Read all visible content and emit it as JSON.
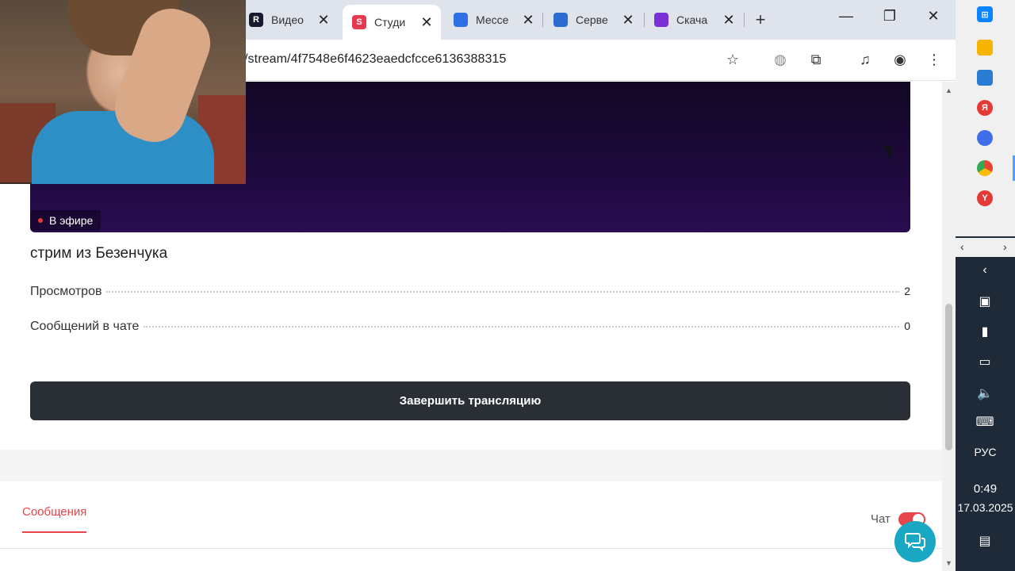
{
  "browser": {
    "tabs": [
      {
        "title": "Видео",
        "fav_letter": "R",
        "fav_color": "#1a1a2e"
      },
      {
        "title": "Студи",
        "fav_letter": "S",
        "fav_color": "#e53950",
        "active": true
      },
      {
        "title": "Мессе",
        "fav_letter": "",
        "fav_color": "#2f6fe4"
      },
      {
        "title": "Серве",
        "fav_letter": "",
        "fav_color": "#2d6bd1"
      },
      {
        "title": "Скача",
        "fav_letter": "",
        "fav_color": "#7b2fd6"
      }
    ],
    "url": "/stream/4f7548e6f4623eaedcfcce6136388315"
  },
  "page": {
    "live_badge": "В эфире",
    "stream_title": "стрим из Безенчука",
    "stats": [
      {
        "label": "Просмотров",
        "value": "2"
      },
      {
        "label": "Сообщений в чате",
        "value": "0"
      }
    ],
    "end_button": "Завершить трансляцию",
    "messages_tab": "Сообщения",
    "chat_label": "Чат",
    "chat_enabled": true
  },
  "taskbar": {
    "language": "РУС",
    "time": "0:49",
    "date": "17.03.2025"
  },
  "colors": {
    "accent": "#e8454a",
    "button_dark": "#2a2f35",
    "support": "#1aa7c4"
  }
}
